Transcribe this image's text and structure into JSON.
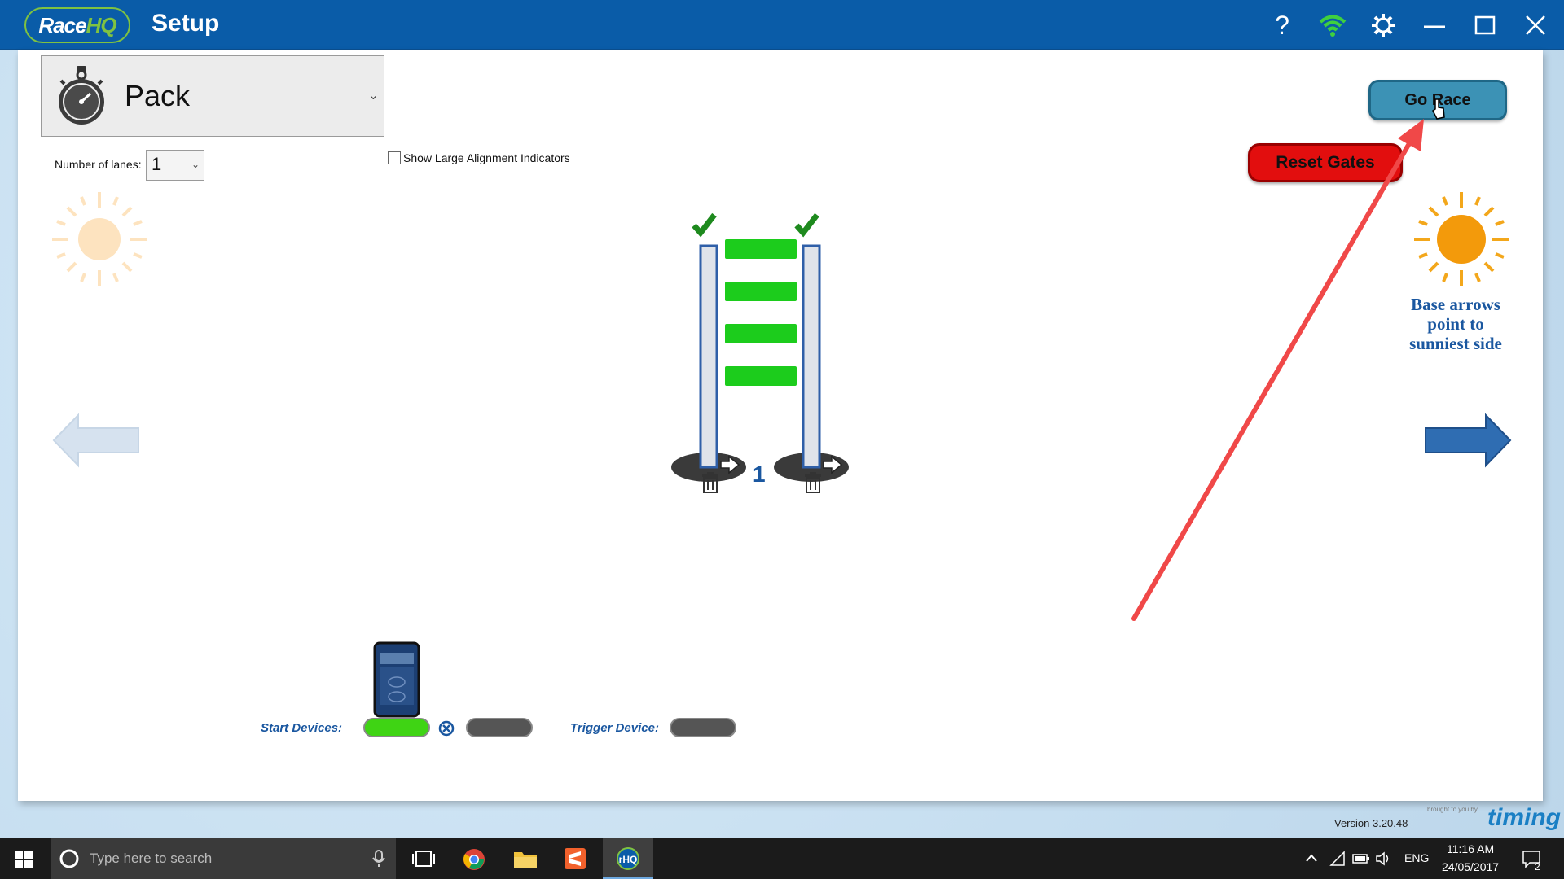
{
  "app": {
    "logo_text": "Race",
    "logo_hq": "HQ",
    "title": "Setup",
    "window_controls": [
      "help-icon",
      "wifi-icon",
      "settings-icon",
      "minimize-icon",
      "maximize-icon",
      "close-icon"
    ]
  },
  "setup": {
    "mode_label": "Pack",
    "lanes_label": "Number of lanes:",
    "lanes_value": "1",
    "align_label": "Show Large Alignment Indicators",
    "align_checked": false,
    "go_race_label": "Go Race",
    "reset_gates_label": "Reset Gates",
    "sunny_text": "Base arrows point to sunniest side",
    "lane_number": "1",
    "start_devices_label": "Start Devices:",
    "trigger_device_label": "Trigger Device:",
    "device_status": {
      "start_1": "connected",
      "start_2": "disconnected",
      "trigger": "disconnected"
    },
    "gate_status": [
      "ok",
      "ok"
    ],
    "version": "Version 3.20.48",
    "brand_small": "brought to you by",
    "brand": "timing"
  },
  "colors": {
    "title_bar": "#0a5ca8",
    "accent_green": "#7fc241",
    "go_race": "#3c92b5",
    "reset": "#e20e0e",
    "sun_active": "#f39a0b",
    "arrow_active": "#2f6db2",
    "lane_green": "#1ccc1c"
  },
  "taskbar": {
    "search_placeholder": "Type here to search",
    "lang": "ENG",
    "time": "11:16 AM",
    "date": "24/05/2017",
    "notifications": "2",
    "apps": [
      "chrome-icon",
      "file-explorer-icon",
      "sublime-icon",
      "racehq-icon"
    ]
  }
}
